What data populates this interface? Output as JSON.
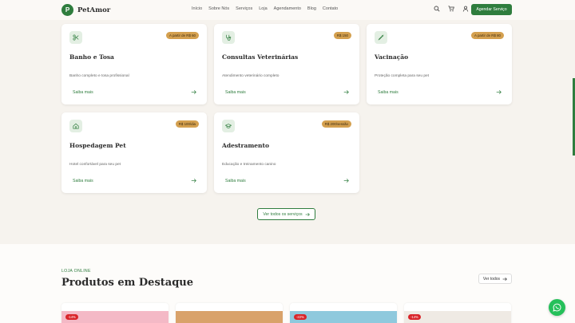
{
  "brand": {
    "mark": "P",
    "name": "PetAmor"
  },
  "nav": [
    "Início",
    "Sobre Nós",
    "Serviços",
    "Loja",
    "Agendamento",
    "Blog",
    "Contato"
  ],
  "header": {
    "cta": "Agendar Serviço"
  },
  "services": [
    {
      "icon": "scissors-icon",
      "badge": "A partir de R$ 60",
      "title": "Banho e Tosa",
      "desc": "Banho completo e tosa profissional",
      "more": "Saiba mais"
    },
    {
      "icon": "stethoscope-icon",
      "badge": "R$ 150",
      "title": "Consultas Veterinárias",
      "desc": "Atendimento veterinário completo",
      "more": "Saiba mais"
    },
    {
      "icon": "syringe-icon",
      "badge": "A partir de R$ 80",
      "title": "Vacinação",
      "desc": "Proteção completa para seu pet",
      "more": "Saiba mais"
    },
    {
      "icon": "home-icon",
      "badge": "R$ 100/dia",
      "title": "Hospedagem Pet",
      "desc": "Hotel confortável para seu pet",
      "more": "Saiba mais"
    },
    {
      "icon": "graduation-cap-icon",
      "badge": "R$ 200/sessão",
      "title": "Adestramento",
      "desc": "Educação e treinamento canino",
      "more": "Saiba mais"
    }
  ],
  "services_cta": "Ver todos os serviços",
  "products": {
    "eyebrow": "LOJA ONLINE",
    "title": "Produtos em Destaque",
    "view_all": "Ver todos",
    "items": [
      {
        "discount": "-14%",
        "color": "#f4b9c6"
      },
      {
        "discount": "",
        "color": "#d9a26a"
      },
      {
        "discount": "-22%",
        "color": "#8fc9dd"
      },
      {
        "discount": "-14%",
        "color": "#efeae4"
      }
    ]
  },
  "colors": {
    "primary": "#2f7d3e",
    "badge": "#d4a04f",
    "whatsapp": "#25c05a"
  }
}
